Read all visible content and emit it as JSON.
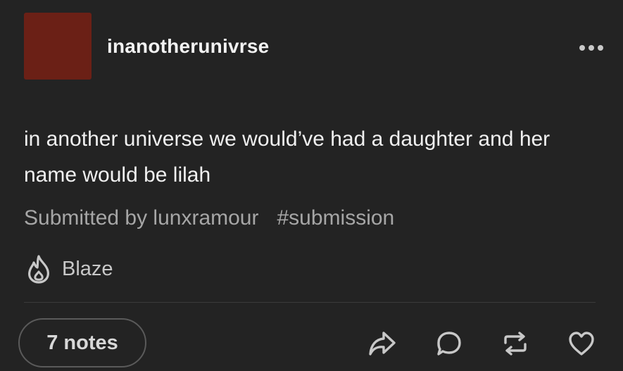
{
  "post": {
    "username": "inanotherunivrse",
    "body": "in another universe we would’ve had a daughter and her name would be lilah",
    "submitted_by": "Submitted by lunxramour",
    "tag": "#submission",
    "blaze_label": "Blaze",
    "notes_label": "7 notes"
  },
  "icons": {
    "more": "more-dots-icon",
    "blaze": "flame-icon",
    "share": "share-arrow-icon",
    "reply": "speech-bubble-icon",
    "reblog": "reblog-icon",
    "like": "heart-icon"
  },
  "colors": {
    "background": "#232323",
    "avatar": "#6b2016",
    "text": "#f0f0f0",
    "muted": "#a6a6a6",
    "icon": "#c8c8c8"
  }
}
